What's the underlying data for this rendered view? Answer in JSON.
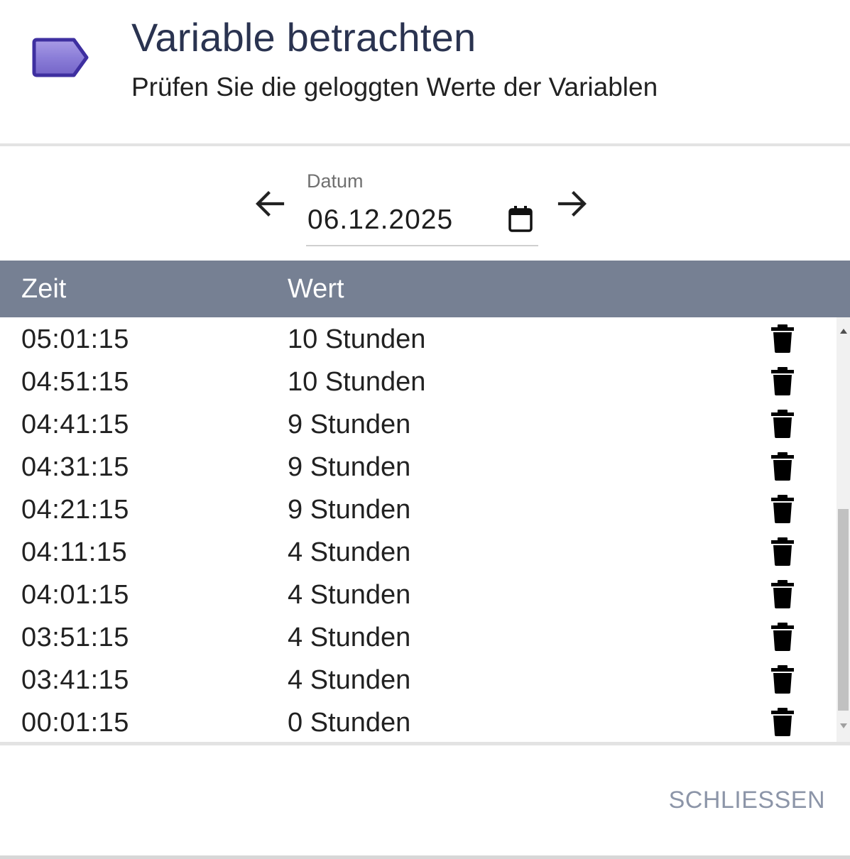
{
  "header": {
    "title": "Variable betrachten",
    "subtitle": "Prüfen Sie die geloggten Werte der Variablen",
    "icon": "tag-icon",
    "icon_color": "#8b7ed8",
    "icon_border_color": "#3e2fa0"
  },
  "date_nav": {
    "label": "Datum",
    "value": "06.12.2025",
    "prev_icon": "arrow-left-icon",
    "next_icon": "arrow-right-icon",
    "calendar_icon": "calendar-icon"
  },
  "table": {
    "columns": [
      "Zeit",
      "Wert"
    ],
    "header_color": "#768093",
    "rows": [
      {
        "time": "05:01:15",
        "value": "10 Stunden"
      },
      {
        "time": "04:51:15",
        "value": "10 Stunden"
      },
      {
        "time": "04:41:15",
        "value": "9 Stunden"
      },
      {
        "time": "04:31:15",
        "value": "9 Stunden"
      },
      {
        "time": "04:21:15",
        "value": "9 Stunden"
      },
      {
        "time": "04:11:15",
        "value": "4 Stunden"
      },
      {
        "time": "04:01:15",
        "value": "4 Stunden"
      },
      {
        "time": "03:51:15",
        "value": "4 Stunden"
      },
      {
        "time": "03:41:15",
        "value": "4 Stunden"
      },
      {
        "time": "00:01:15",
        "value": "0 Stunden"
      }
    ],
    "row_action_icon": "trash-icon"
  },
  "footer": {
    "close_label": "SCHLIESSEN"
  }
}
